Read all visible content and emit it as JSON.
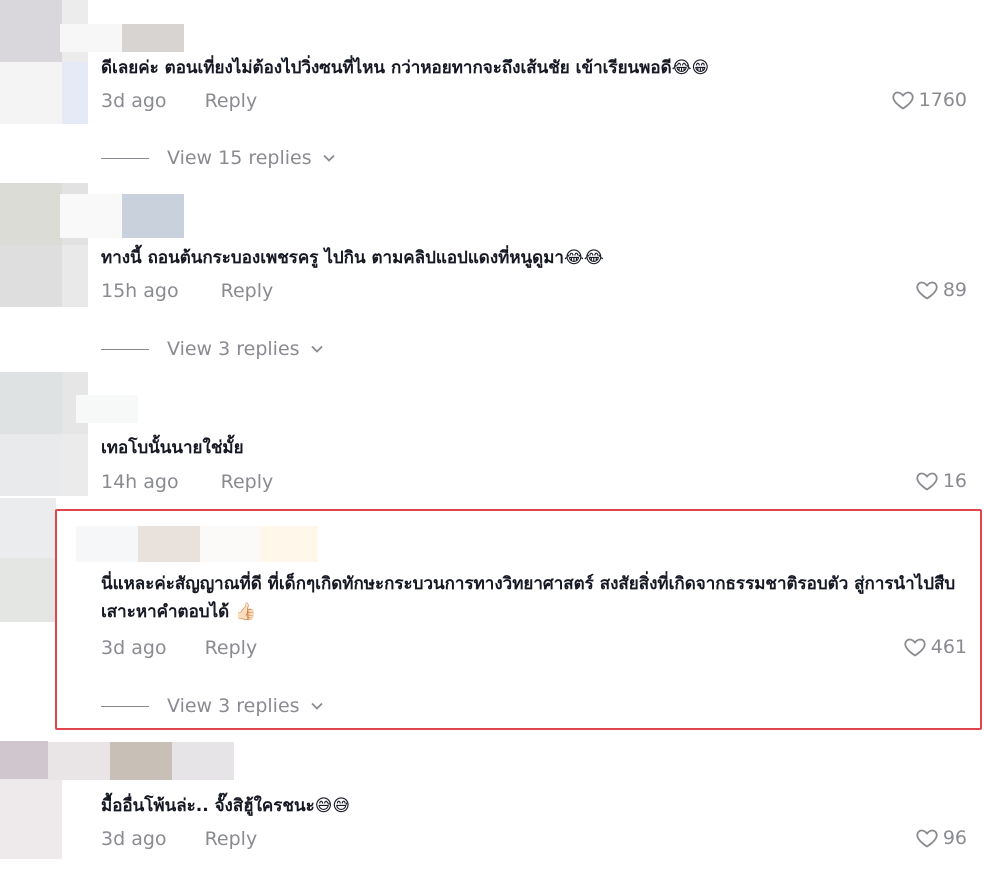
{
  "comments": [
    {
      "text": "ดีเลยค่ะ ตอนเที่ยงไม่ต้องไปวิ่งซนที่ไหน กว่าหอยทากจะถึงเส้นชัย เข้าเรียนพอดี",
      "emoji": "😂😁",
      "time": "3d ago",
      "reply": "Reply",
      "likes": "1760",
      "view_replies": "View 15 replies"
    },
    {
      "text": "ทางนี้ ถอนต้นกระบองเพชรครู ไปกิน ตามคลิปแอปแดงที่หนูดูมา",
      "emoji": "😂😂",
      "time": "15h ago",
      "reply": "Reply",
      "likes": "89",
      "view_replies": "View 3 replies"
    },
    {
      "text": "เทอโบนั้นนายใช่มั้ย",
      "emoji": "",
      "time": "14h ago",
      "reply": "Reply",
      "likes": "16",
      "view_replies": ""
    },
    {
      "text": "นี่แหละค่ะสัญญาณที่ดี ที่เด็กๆเกิดทักษะกระบวนการทางวิทยาศาสตร์ สงสัยสิ่งที่เกิดจากธรรมชาติรอบตัว สู่การนำไปสืบเสาะหาคำตอบได้",
      "emoji": "👍🏻",
      "time": "3d ago",
      "reply": "Reply",
      "likes": "461",
      "view_replies": "View 3 replies"
    },
    {
      "text": "มื้ออื่นโพ้นล่ะ.. จั๊งสิฮู้ใครชนะ",
      "emoji": "😅😅",
      "time": "3d ago",
      "reply": "Reply",
      "likes": "96",
      "view_replies": ""
    }
  ],
  "icons": {
    "like": "heart-outline-icon",
    "expand": "chevron-down-icon"
  },
  "colors": {
    "text": "#161823",
    "muted": "#8a8b91",
    "highlight_border": "#e0454d"
  }
}
